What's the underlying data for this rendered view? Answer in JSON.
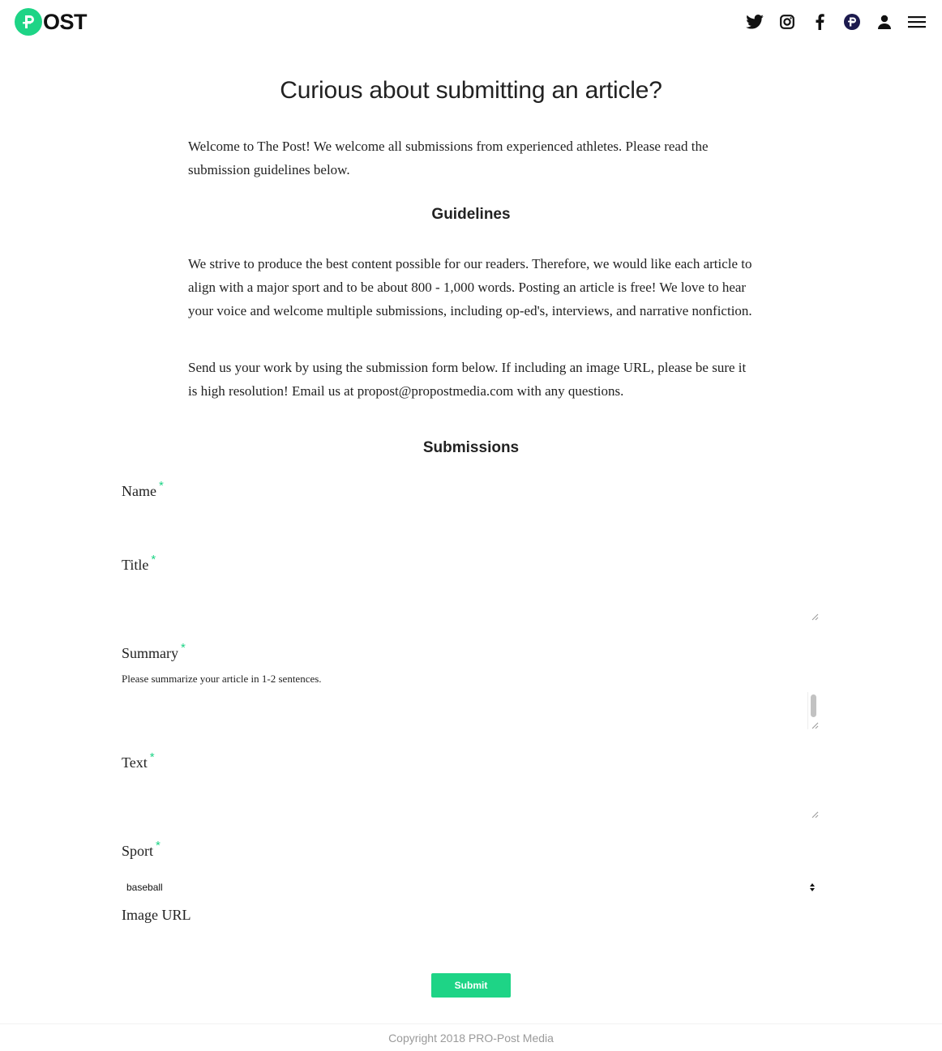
{
  "header": {
    "logo_letter": "P",
    "logo_text": "OST",
    "icons": [
      "twitter-icon",
      "instagram-icon",
      "facebook-icon",
      "propost-icon",
      "user-icon",
      "menu-icon"
    ]
  },
  "page": {
    "title": "Curious about submitting an article?",
    "intro": "Welcome to The Post! We welcome all submissions from experienced athletes. Please read the submission guidelines below.",
    "guidelines_heading": "Guidelines",
    "guidelines_text": "We strive to produce the best content possible for our readers. Therefore, we would like each article to align with a major sport and to be about 800 - 1,000 words. Posting an article is free! We love to hear your voice and welcome multiple submissions, including op-ed's, interviews, and narrative nonfiction.",
    "send_text": "Send us your work by using the submission form below. If including an image URL, please be sure it is high resolution! Email us at propost@propostmedia.com with any questions.",
    "submissions_heading": "Submissions"
  },
  "form": {
    "required_mark": "*",
    "name_label": "Name",
    "title_label": "Title",
    "summary_label": "Summary",
    "summary_helper": "Please summarize your article in 1-2 sentences.",
    "text_label": "Text",
    "sport_label": "Sport",
    "sport_value": "baseball",
    "image_url_label": "Image URL",
    "submit_label": "Submit"
  },
  "footer": {
    "copyright": "Copyright 2018 PRO-Post Media"
  },
  "colors": {
    "accent": "#1ed486",
    "text": "#222222",
    "footer_text": "#9a9a9a"
  }
}
